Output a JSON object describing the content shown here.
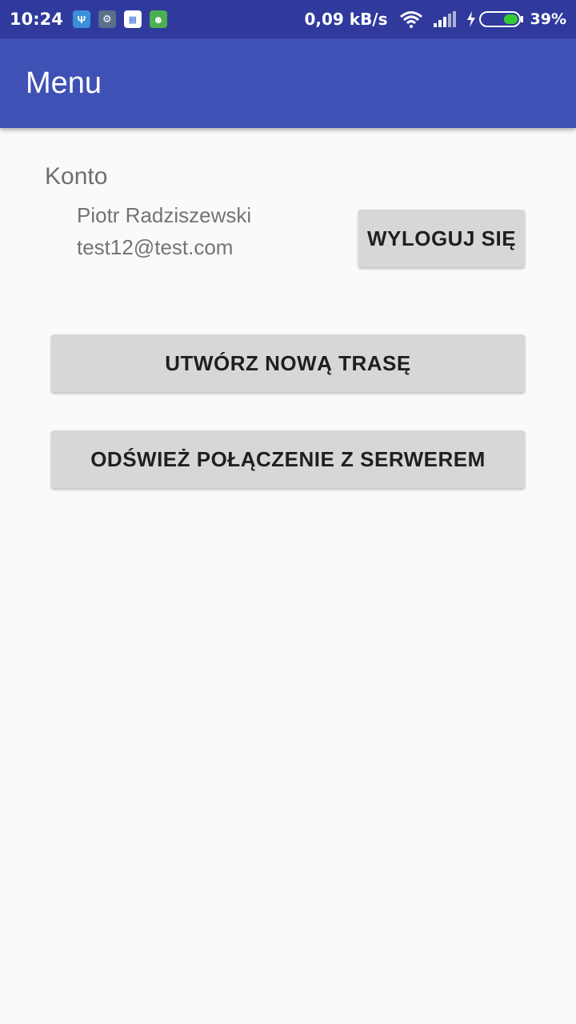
{
  "status_bar": {
    "time": "10:24",
    "net_speed": "0,09 kB/s",
    "battery_percent": "39%",
    "battery_level": 0.39,
    "notification_icons": [
      "usb-icon",
      "settings-icon",
      "calendar-icon",
      "android-icon"
    ],
    "background_color": "#2f3a9c"
  },
  "app_bar": {
    "title": "Menu",
    "background_color": "#3f51b5"
  },
  "account": {
    "section_label": "Konto",
    "user_name": "Piotr Radziszewski",
    "user_email": "test12@test.com",
    "logout_label": "WYLOGUJ SIĘ"
  },
  "actions": {
    "create_route_label": "UTWÓRZ NOWĄ TRASĘ",
    "refresh_connection_label": "ODŚWIEŻ POŁĄCZENIE Z SERWEREM"
  }
}
